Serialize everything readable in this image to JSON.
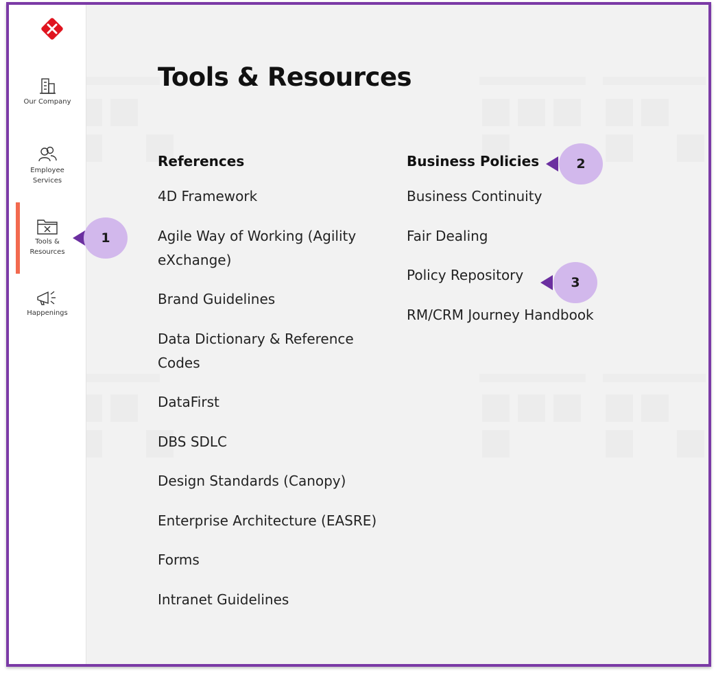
{
  "sidebar": {
    "items": [
      {
        "label": "Our Company",
        "icon": "building-icon"
      },
      {
        "label": "Employee Services",
        "icon": "people-icon"
      },
      {
        "label": "Tools & Resources",
        "icon": "folder-tools-icon"
      },
      {
        "label": "Happenings",
        "icon": "megaphone-icon"
      }
    ],
    "active_index": 2
  },
  "page": {
    "title": "Tools & Resources"
  },
  "references": {
    "heading": "References",
    "items": [
      "4D Framework",
      "Agile Way of Working (Agility eXchange)",
      "Brand Guidelines",
      "Data Dictionary & Reference Codes",
      "DataFirst",
      "DBS SDLC",
      "Design Standards (Canopy)",
      "Enterprise Architecture (EASRE)",
      "Forms",
      "Intranet Guidelines"
    ]
  },
  "business_policies": {
    "heading": "Business Policies",
    "items": [
      "Business Continuity",
      "Fair Dealing",
      "Policy Repository",
      "RM/CRM Journey Handbook"
    ]
  },
  "callouts": [
    "1",
    "2",
    "3"
  ],
  "colors": {
    "frame": "#7b3aa6",
    "active_bar": "#f26a4f",
    "logo": "#e0141f",
    "callout_fill": "#d2b8ec",
    "callout_arrow": "#6b2fa0"
  }
}
